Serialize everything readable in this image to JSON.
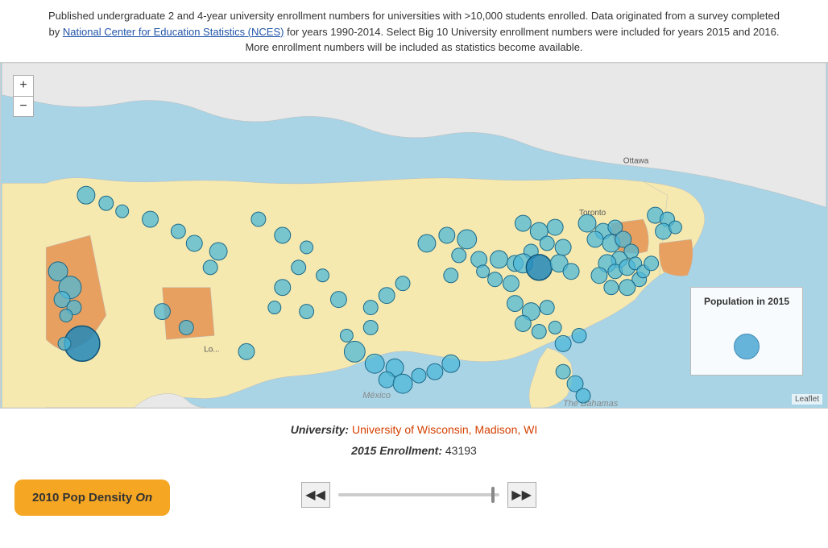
{
  "header": {
    "text": "Published undergraduate 2 and 4-year university enrollment numbers for universities with >10,000 students enrolled. Data originated from a survey completed by",
    "link_text": "National Center for Education Statistics (NCES)",
    "link_url": "#",
    "text2": "for years 1990-2014. Select Big 10 University enrollment numbers were included for years 2015 and 2016. More enrollment numbers will be included as statistics become available."
  },
  "map": {
    "zoom_plus": "+",
    "zoom_minus": "−",
    "attribution": "Leaflet"
  },
  "legend": {
    "title": "Population in 2015",
    "circle_size": 32
  },
  "university": {
    "label": "University:",
    "name": "University of Wisconsin, Madison, WI"
  },
  "enrollment": {
    "label": "2015 Enrollment:",
    "value": "43193"
  },
  "toggle_button": {
    "text_prefix": "2010 Pop Density ",
    "text_suffix": "On"
  },
  "controls": {
    "prev_label": "◀◀",
    "next_label": "▶▶"
  }
}
